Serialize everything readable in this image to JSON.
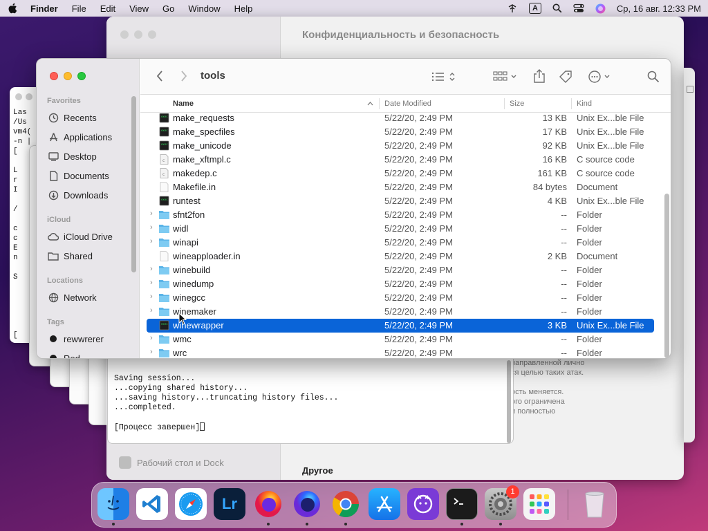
{
  "menubar": {
    "items": [
      "Finder",
      "File",
      "Edit",
      "View",
      "Go",
      "Window",
      "Help"
    ],
    "input_source": "A",
    "datetime": "Ср, 16 авг. 12:33 PM"
  },
  "settings_window": {
    "title": "Конфиденциальность и безопасность",
    "sidebar_item": "Рабочий стол и Dock",
    "section": "Другое",
    "description_lines": [
      "направленной лично",
      "ся целью таких атак.",
      "",
      "ость меняется.",
      "ого ограничена",
      "и полностью"
    ]
  },
  "left_terminal": {
    "lines": [
      "Las",
      "/Us",
      "vm4(",
      "-n |",
      "[",
      "",
      "L",
      "r",
      "I",
      "",
      "/",
      "",
      "c",
      "c",
      "E",
      "n",
      "",
      "S",
      "",
      "",
      "",
      "",
      "",
      "["
    ]
  },
  "terminal": {
    "lines": [
      "Saving session...",
      "...copying shared history...",
      "...saving history...truncating history files...",
      "...completed.",
      ""
    ],
    "last_line": "[Процесс завершен]"
  },
  "finder": {
    "path": "tools",
    "sidebar": {
      "favorites_label": "Favorites",
      "favorites": [
        "Recents",
        "Applications",
        "Desktop",
        "Documents",
        "Downloads"
      ],
      "icloud_label": "iCloud",
      "icloud": [
        "iCloud Drive",
        "Shared"
      ],
      "locations_label": "Locations",
      "locations": [
        "Network"
      ],
      "tags_label": "Tags",
      "tags": [
        "rewwrerer",
        "Red"
      ]
    },
    "columns": {
      "name": "Name",
      "date": "Date Modified",
      "size": "Size",
      "kind": "Kind"
    },
    "rows": [
      {
        "name": "make_requests",
        "date": "5/22/20, 2:49 PM",
        "size": "13 KB",
        "kind": "Unix Ex...ble File",
        "type": "exec",
        "folder": false
      },
      {
        "name": "make_specfiles",
        "date": "5/22/20, 2:49 PM",
        "size": "17 KB",
        "kind": "Unix Ex...ble File",
        "type": "exec",
        "folder": false
      },
      {
        "name": "make_unicode",
        "date": "5/22/20, 2:49 PM",
        "size": "92 KB",
        "kind": "Unix Ex...ble File",
        "type": "exec",
        "folder": false
      },
      {
        "name": "make_xftmpl.c",
        "date": "5/22/20, 2:49 PM",
        "size": "16 KB",
        "kind": "C source code",
        "type": "csrc",
        "folder": false
      },
      {
        "name": "makedep.c",
        "date": "5/22/20, 2:49 PM",
        "size": "161 KB",
        "kind": "C source code",
        "type": "csrc",
        "folder": false
      },
      {
        "name": "Makefile.in",
        "date": "5/22/20, 2:49 PM",
        "size": "84 bytes",
        "kind": "Document",
        "type": "doc",
        "folder": false
      },
      {
        "name": "runtest",
        "date": "5/22/20, 2:49 PM",
        "size": "4 KB",
        "kind": "Unix Ex...ble File",
        "type": "exec",
        "folder": false
      },
      {
        "name": "sfnt2fon",
        "date": "5/22/20, 2:49 PM",
        "size": "--",
        "kind": "Folder",
        "type": "folder",
        "folder": true
      },
      {
        "name": "widl",
        "date": "5/22/20, 2:49 PM",
        "size": "--",
        "kind": "Folder",
        "type": "folder",
        "folder": true
      },
      {
        "name": "winapi",
        "date": "5/22/20, 2:49 PM",
        "size": "--",
        "kind": "Folder",
        "type": "folder",
        "folder": true
      },
      {
        "name": "wineapploader.in",
        "date": "5/22/20, 2:49 PM",
        "size": "2 KB",
        "kind": "Document",
        "type": "doc",
        "folder": false
      },
      {
        "name": "winebuild",
        "date": "5/22/20, 2:49 PM",
        "size": "--",
        "kind": "Folder",
        "type": "folder",
        "folder": true
      },
      {
        "name": "winedump",
        "date": "5/22/20, 2:49 PM",
        "size": "--",
        "kind": "Folder",
        "type": "folder",
        "folder": true
      },
      {
        "name": "winegcc",
        "date": "5/22/20, 2:49 PM",
        "size": "--",
        "kind": "Folder",
        "type": "folder",
        "folder": true
      },
      {
        "name": "winemaker",
        "date": "5/22/20, 2:49 PM",
        "size": "--",
        "kind": "Folder",
        "type": "folder",
        "folder": true
      },
      {
        "name": "winewrapper",
        "date": "5/22/20, 2:49 PM",
        "size": "3 KB",
        "kind": "Unix Ex...ble File",
        "type": "exec",
        "folder": false,
        "selected": true
      },
      {
        "name": "wmc",
        "date": "5/22/20, 2:49 PM",
        "size": "--",
        "kind": "Folder",
        "type": "folder",
        "folder": true
      },
      {
        "name": "wrc",
        "date": "5/22/20, 2:49 PM",
        "size": "--",
        "kind": "Folder",
        "type": "folder",
        "folder": true
      }
    ]
  },
  "dock": {
    "apps": [
      "finder-icon",
      "vscode-icon",
      "safari-icon",
      "lightroom-icon",
      "firefox-icon",
      "firefox-dev-icon",
      "chrome-icon",
      "app-store-icon",
      "github-desktop-icon",
      "terminal-icon",
      "system-settings-icon",
      "launchpad-icon",
      "trash-icon"
    ],
    "lightroom_label": "Lr",
    "settings_badge": "1"
  },
  "colors": {
    "selection": "#0a64d8",
    "folder": "#5ab4e8",
    "accent_red": "#ff3b30"
  }
}
